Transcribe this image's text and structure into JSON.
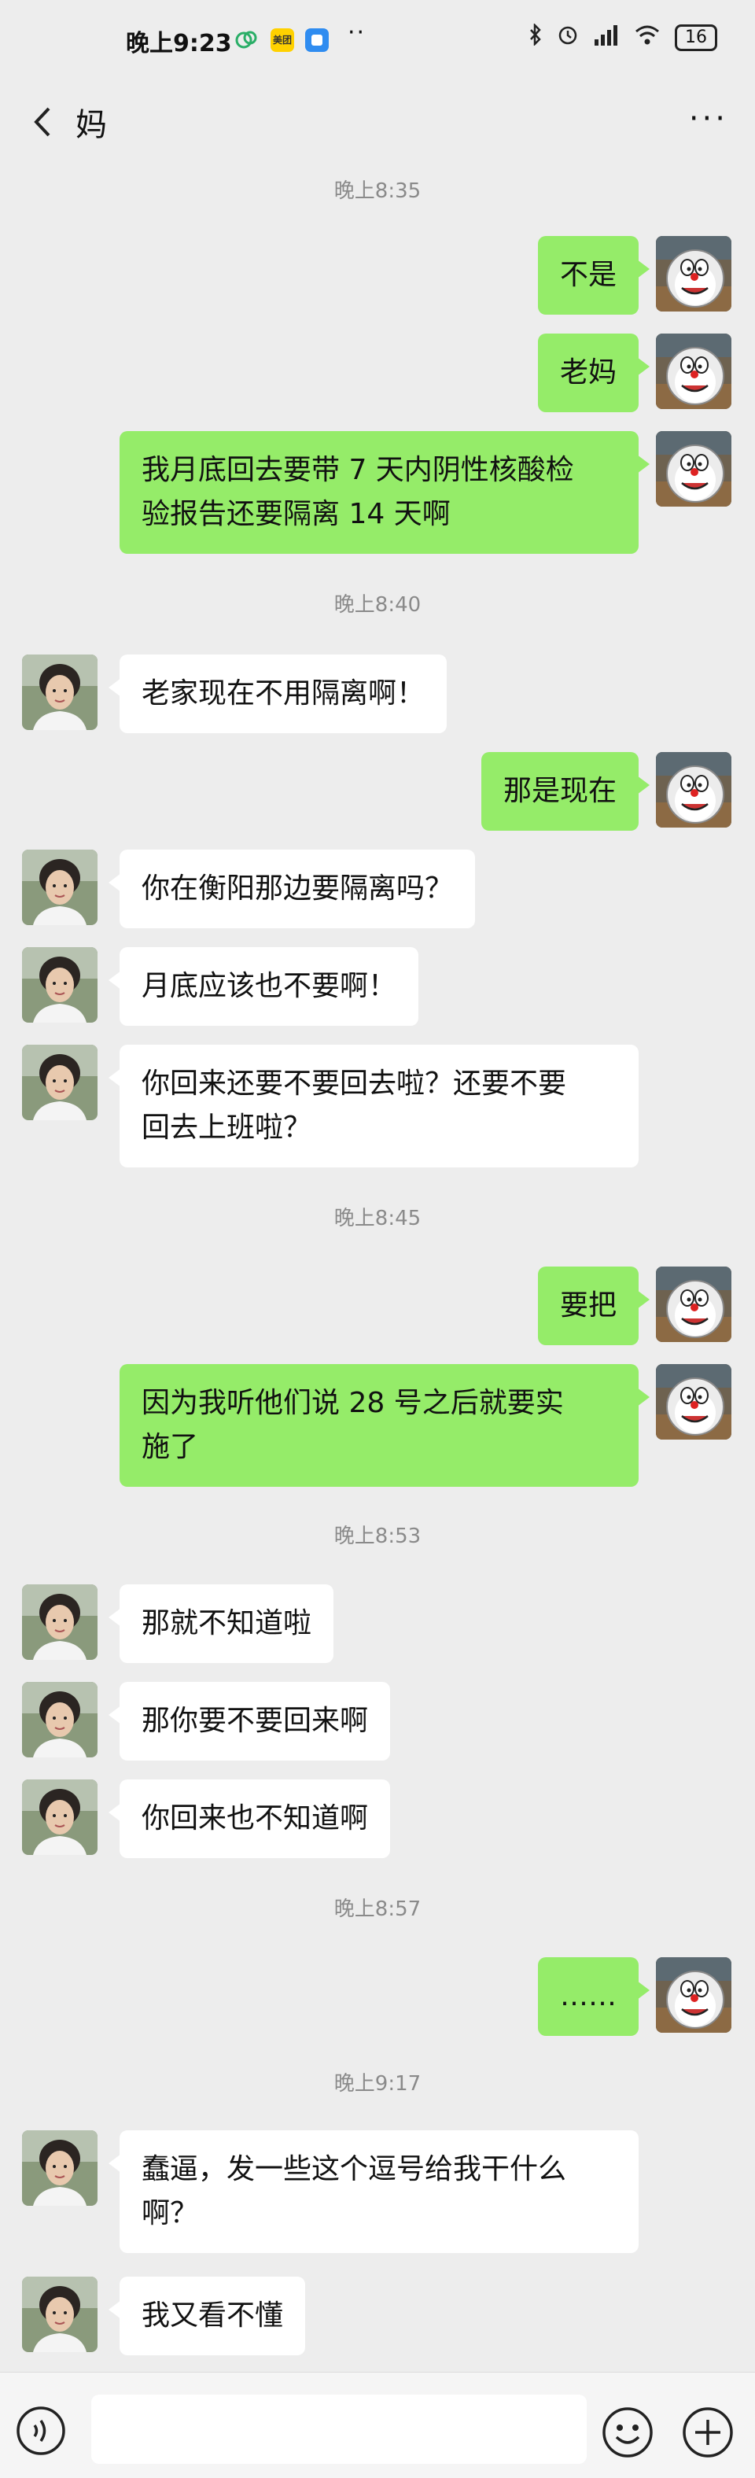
{
  "status_bar": {
    "time": "晚上9:23",
    "app_badge": "美团",
    "dots": "··",
    "battery": "16"
  },
  "chat": {
    "title": "妈",
    "more": "···"
  },
  "messages": {
    "ts1": "晚上8:35",
    "m1": "不是",
    "m2": "老妈",
    "m3a": "我月底回去要带 7 天内阴性核酸检",
    "m3b": "验报告还要隔离 14 天啊",
    "ts2": "晚上8:40",
    "m4": "老家现在不用隔离啊！",
    "m5": "那是现在",
    "m6": "你在衡阳那边要隔离吗？",
    "m7": "月底应该也不要啊！",
    "m8a": "你回来还要不要回去啦？还要不要",
    "m8b": "回去上班啦？",
    "ts3": "晚上8:45",
    "m9": "要把",
    "m10a": "因为我听他们说 28 号之后就要实",
    "m10b": "施了",
    "ts4": "晚上8:53",
    "m11": "那就不知道啦",
    "m12": "那你要不要回来啊",
    "m13": "你回来也不知道啊",
    "ts5": "晚上8:57",
    "m14": "……",
    "ts6": "晚上9:17",
    "m15a": "蠢逼，发一些这个逗号给我干什么",
    "m15b": "啊？",
    "m16": "我又看不懂"
  },
  "icons": {
    "back": "chevron-left-icon",
    "more": "more-dots-icon",
    "voice": "voice-icon",
    "emoji": "emoji-icon",
    "plus": "plus-icon"
  },
  "colors": {
    "sent_bubble": "#95ec69",
    "recv_bubble": "#ffffff",
    "background": "#ededed"
  }
}
